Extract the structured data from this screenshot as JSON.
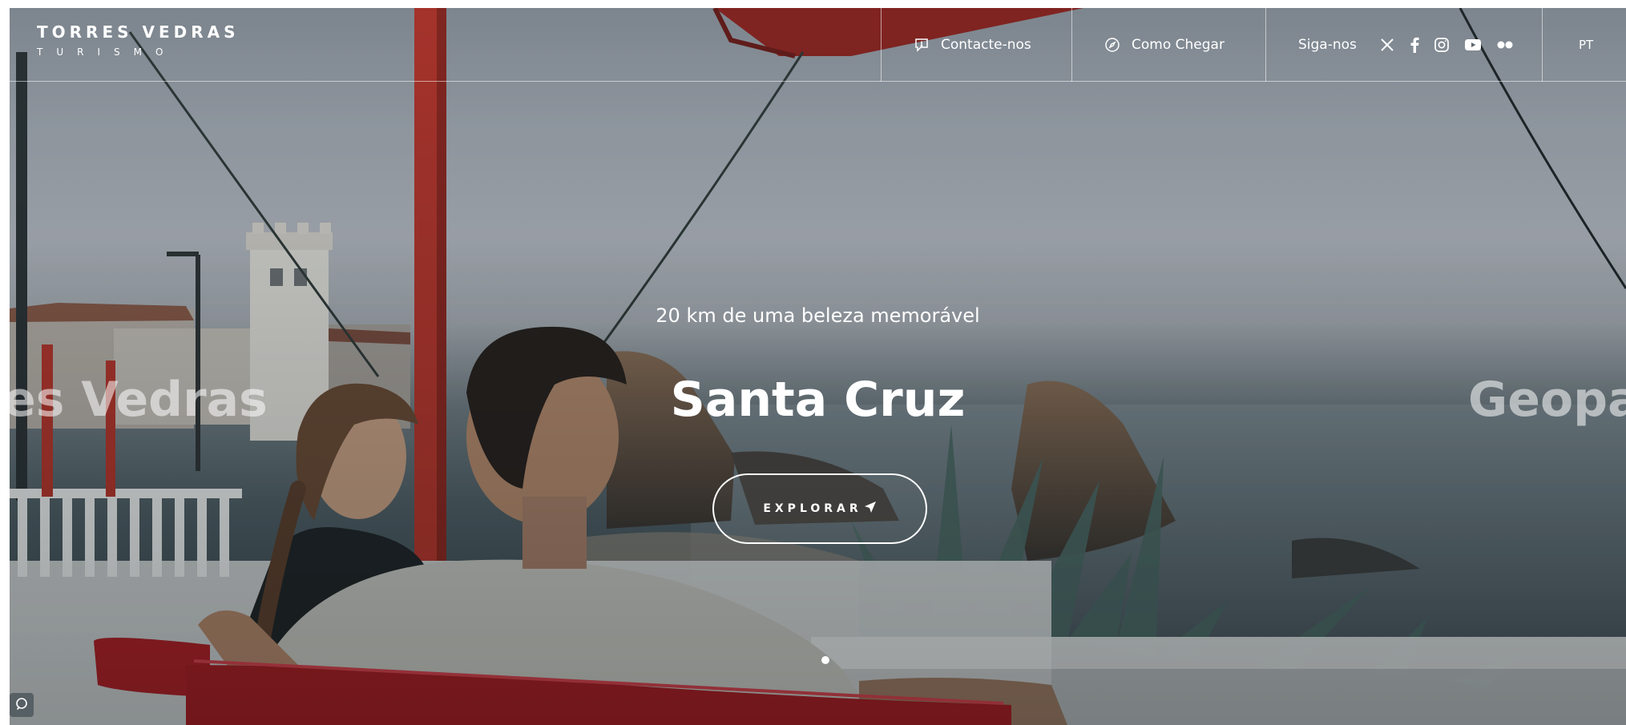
{
  "brand": {
    "name": "TORRES VEDRAS",
    "sub": "TURISMO"
  },
  "nav": {
    "contact_label": "Contacte-nos",
    "directions_label": "Como Chegar",
    "social_label": "Siga-nos",
    "social_icons": [
      "x-icon",
      "facebook-icon",
      "instagram-icon",
      "youtube-icon",
      "flickr-icon"
    ],
    "language": "PT"
  },
  "slider": {
    "subtitle": "20 km de uma beleza memorável",
    "current_title": "Santa Cruz",
    "prev_title": "es Vedras",
    "next_title": "Geopa",
    "cta_label": "EXPLORAR",
    "active_slide": 1
  },
  "colors": {
    "sky": "#b9bdc5",
    "sea": "#4f5f66",
    "bench": "#b01e24",
    "post": "#c2382e",
    "text": "#ffffff"
  }
}
